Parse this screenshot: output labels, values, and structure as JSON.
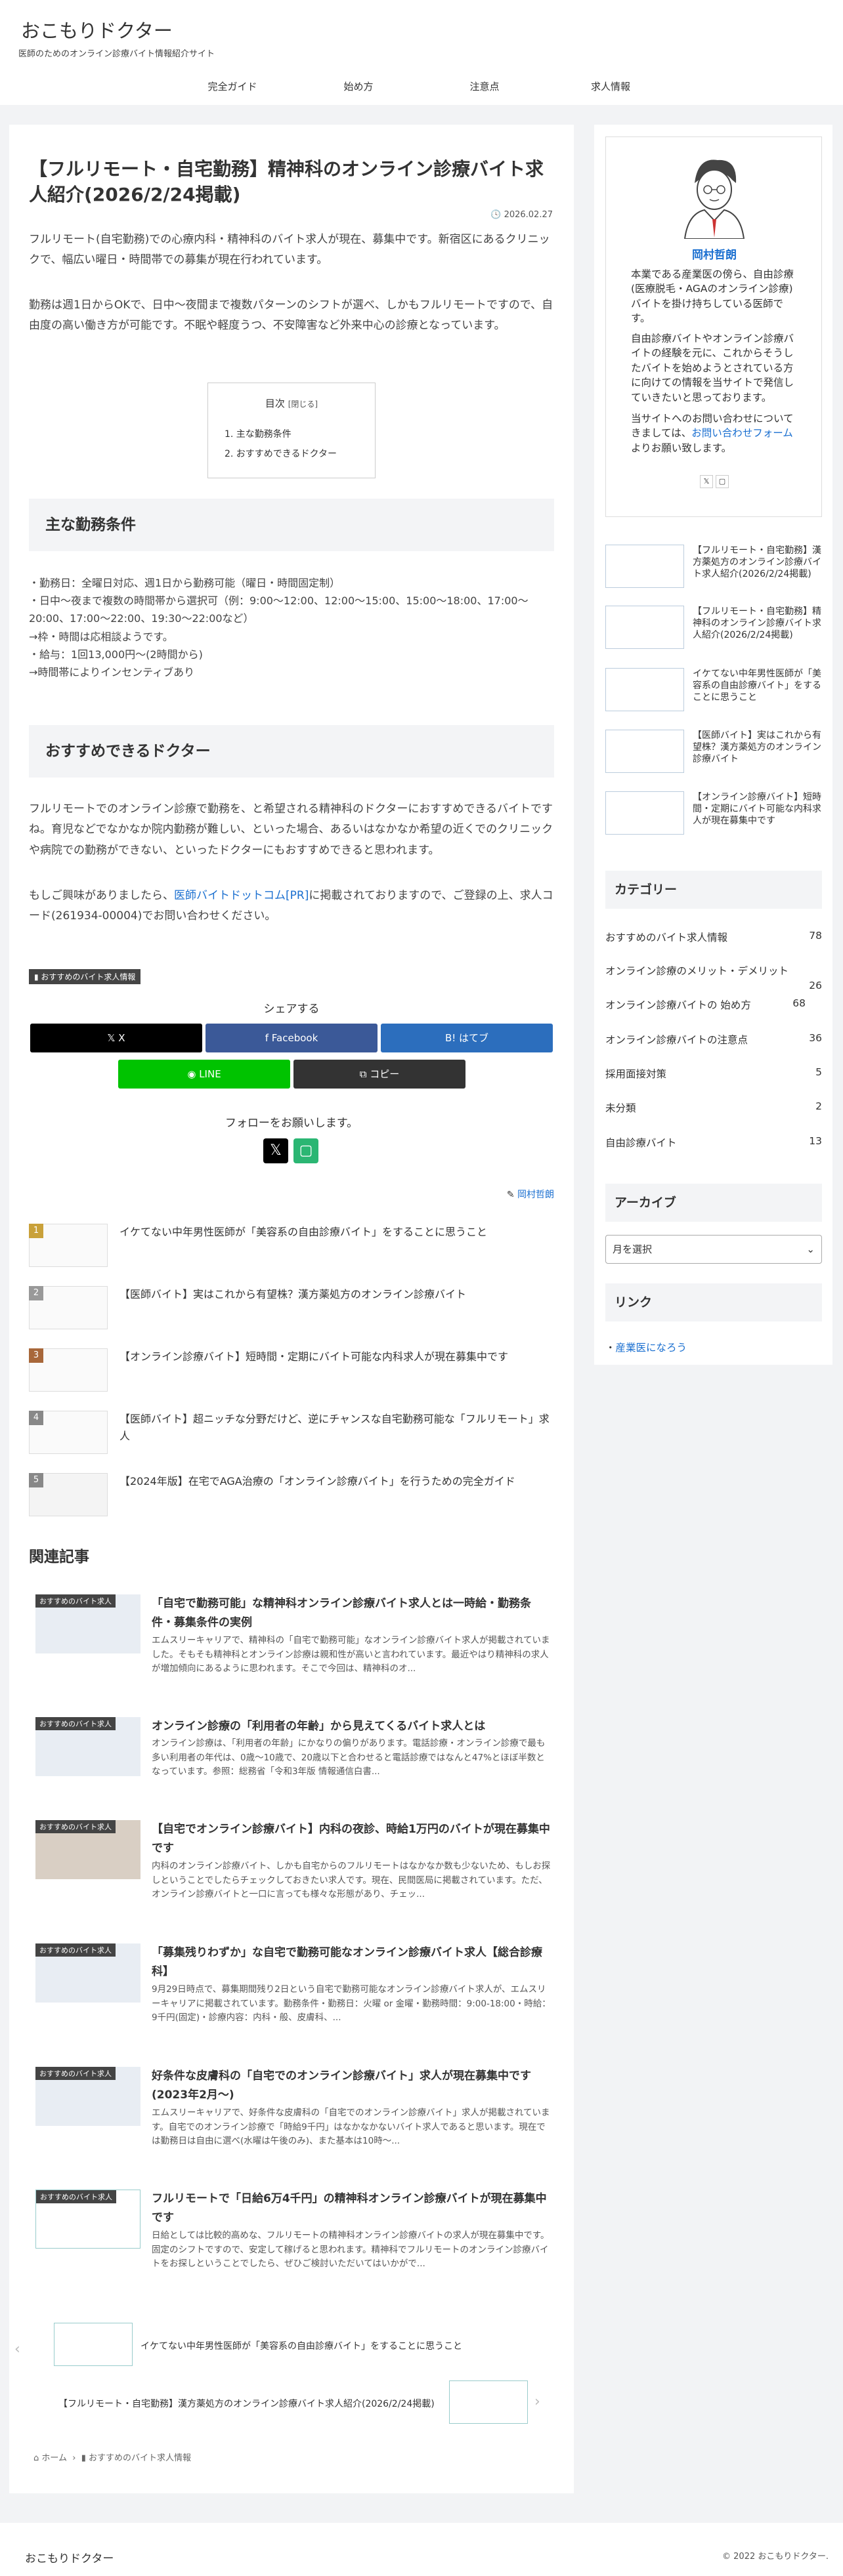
{
  "site": {
    "title": "おこもりドクター",
    "description": "医師のためのオンライン診療バイト情報紹介サイト"
  },
  "nav": [
    "完全ガイド",
    "始め方",
    "注意点",
    "求人情報"
  ],
  "article": {
    "title": "【フルリモート・自宅勤務】精神科のオンライン診療バイト求人紹介(2026/2/24掲載)",
    "date": "2026.02.27",
    "intro1": "フルリモート(自宅勤務)での心療内科・精神科のバイト求人が現在、募集中です。新宿区にあるクリニックで、幅広い曜日・時間帯での募集が現在行われています。",
    "intro2": "勤務は週1日からOKで、日中〜夜間まで複数パターンのシフトが選べ、しかもフルリモートですので、自由度の高い働き方が可能です。不眠や軽度うつ、不安障害など外来中心の診療となっています。",
    "toc": {
      "title": "目次",
      "toggle": "[閉じる]",
      "items": [
        "1. 主な勤務条件",
        "2. おすすめできるドクター"
      ]
    },
    "h2_1": "主な勤務条件",
    "conditions": [
      "・勤務日：全曜日対応、週1日から勤務可能（曜日・時間固定制）",
      "・日中〜夜まで複数の時間帯から選択可（例：9:00〜12:00、12:00〜15:00、15:00〜18:00、17:00〜20:00、17:00〜22:00、19:30〜22:00など）",
      "→枠・時間は応相談ようです。",
      "・給与：1回13,000円〜(2時間から)",
      "→時間帯によりインセンティブあり"
    ],
    "h2_2": "おすすめできるドクター",
    "rec": "フルリモートでのオンライン診療で勤務を、と希望される精神科のドクターにおすすめできるバイトですね。育児などでなかなか院内勤務が難しい、といった場合、あるいはなかなか希望の近くでのクリニックや病院での勤務ができない、といったドクターにもおすすめできると思われます。",
    "contact_pre": "もしご興味がありましたら、",
    "contact_link": "医師バイトドットコム[PR]",
    "contact_post": "に掲載されておりますので、ご登録の上、求人コード(261934-00004)でお問い合わせください。",
    "category": "おすすめのバイト求人情報"
  },
  "share": {
    "title": "シェアする",
    "buttons": [
      "X",
      "Facebook",
      "はてブ",
      "LINE",
      "コピー"
    ],
    "colors": [
      "#000000",
      "#3b5998",
      "#2c6ebd",
      "#00c300",
      "#333333"
    ]
  },
  "follow": {
    "title": "フォローをお願いします。"
  },
  "author_link": "岡村哲朗",
  "ranking": [
    {
      "num": "1",
      "title": "イケてない中年男性医師が「美容系の自由診療バイト」をすることに思うこと"
    },
    {
      "num": "2",
      "title": "【医師バイト】実はこれから有望株？漢方薬処方のオンライン診療バイト"
    },
    {
      "num": "3",
      "title": "【オンライン診療バイト】短時間・定期にバイト可能な内科求人が現在募集中です"
    },
    {
      "num": "4",
      "title": "【医師バイト】超ニッチな分野だけど、逆にチャンスな自宅勤務可能な「フルリモート」求人"
    },
    {
      "num": "5",
      "title": "【2024年版】在宅でAGA治療の「オンライン診療バイト」を行うための完全ガイド"
    }
  ],
  "related": {
    "heading": "関連記事",
    "label": "おすすめのバイト求人",
    "items": [
      {
        "title": "「自宅で勤務可能」な精神科オンライン診療バイト求人とは一時給・勤務条件・募集条件の実例",
        "snippet": "エムスリーキャリアで、精神科の「自宅で勤務可能」なオンライン診療バイト求人が掲載されていました。そもそも精神科とオンライン診療は親和性が高いと言われています。最近やはり精神科の求人が増加傾向にあるように思われます。そこで今回は、精神科のオ..."
      },
      {
        "title": "オンライン診療の「利用者の年齢」から見えてくるバイト求人とは",
        "snippet": "オンライン診療は、「利用者の年齢」にかなりの偏りがあります。電話診療・オンライン診療で最も多い利用者の年代は、0歳〜10歳で、20歳以下と合わせると電話診療ではなんと47%とほぼ半数となっています。参照：総務省「令和3年版 情報通信白書..."
      },
      {
        "title": "【自宅でオンライン診療バイト】内科の夜診、時給1万円のバイトが現在募集中です",
        "snippet": "内科のオンライン診療バイト、しかも自宅からのフルリモートはなかなか数も少ないため、もしお探しということでしたらチェックしておきたい求人です。現在、民間医局に掲載されています。ただ、オンライン診療バイトと一口に言っても様々な形態があり、チェッ..."
      },
      {
        "title": "「募集残りわずか」な自宅で勤務可能なオンライン診療バイト求人【総合診療科】",
        "snippet": "9月29日時点で、募集期間残り2日という自宅で勤務可能なオンライン診療バイト求人が、エムスリーキャリアに掲載されています。勤務条件・勤務日：火曜 or 金曜・勤務時間：9:00-18:00・時給：9千円(固定)・診療内容：内科・般、皮膚科、..."
      },
      {
        "title": "好条件な皮膚科の「自宅でのオンライン診療バイト」求人が現在募集中です(2023年2月〜)",
        "snippet": "エムスリーキャリアで、好条件な皮膚科の「自宅でのオンライン診療バイト」求人が掲載されています。自宅でのオンライン診療で「時給9千円」はなかなかないバイト求人であると思います。現在では勤務日は自由に選べ(水曜は午後のみ)、また基本は10時〜..."
      },
      {
        "title": "フルリモートで「日給6万4千円」の精神科オンライン診療バイトが現在募集中です",
        "snippet": "日給としては比較的高めな、フルリモートの精神科オンライン診療バイトの求人が現在募集中です。固定のシフトですので、安定して稼げると思われます。精神科でフルリモートのオンライン診療バイトをお探しということでしたら、ぜひご検討いただいてはいかがで..."
      }
    ]
  },
  "pager": {
    "prev": "イケてない中年男性医師が「美容系の自由診療バイト」をすることに思うこと",
    "next": "【フルリモート・自宅勤務】漢方薬処方のオンライン診療バイト求人紹介(2026/2/24掲載)"
  },
  "breadcrumb": {
    "home": "ホーム",
    "category": "おすすめのバイト求人情報"
  },
  "profile": {
    "name": "岡村哲朗",
    "text1": "本業である産業医の傍ら、自由診療(医療脱毛・AGAのオンライン診療)バイトを掛け持ちしている医師です。",
    "text2": "自由診療バイトやオンライン診療バイトの経験を元に、これからそうしたバイトを始めようとされている方に向けての情報を当サイトで発信していきたいと思っております。",
    "text3_pre": "当サイトへのお問い合わせについてきましては、",
    "text3_link": "お問い合わせフォーム",
    "text3_post": "よりお願い致します。"
  },
  "side_posts": [
    "【フルリモート・自宅勤務】漢方薬処方のオンライン診療バイト求人紹介(2026/2/24掲載)",
    "【フルリモート・自宅勤務】精神科のオンライン診療バイト求人紹介(2026/2/24掲載)",
    "イケてない中年男性医師が「美容系の自由診療バイト」をすることに思うこと",
    "【医師バイト】実はこれから有望株？漢方薬処方のオンライン診療バイト",
    "【オンライン診療バイト】短時間・定期にバイト可能な内科求人が現在募集中です"
  ],
  "categories": {
    "heading": "カテゴリー",
    "items": [
      {
        "name": "おすすめのバイト求人情報",
        "count": "78"
      },
      {
        "name": "オンライン診療のメリット・デメリット",
        "count": "26"
      },
      {
        "name": "オンライン診療バイトの 始め方",
        "count": "68"
      },
      {
        "name": "オンライン診療バイトの注意点",
        "count": "36"
      },
      {
        "name": "採用面接対策",
        "count": "5"
      },
      {
        "name": "未分類",
        "count": "2"
      },
      {
        "name": "自由診療バイト",
        "count": "13"
      }
    ]
  },
  "archive": {
    "heading": "アーカイブ",
    "select": "月を選択"
  },
  "links": {
    "heading": "リンク",
    "item": "産業医になろう"
  },
  "footer": {
    "logo": "おこもりドクター",
    "copyright": "© 2022 おこもりドクター."
  }
}
